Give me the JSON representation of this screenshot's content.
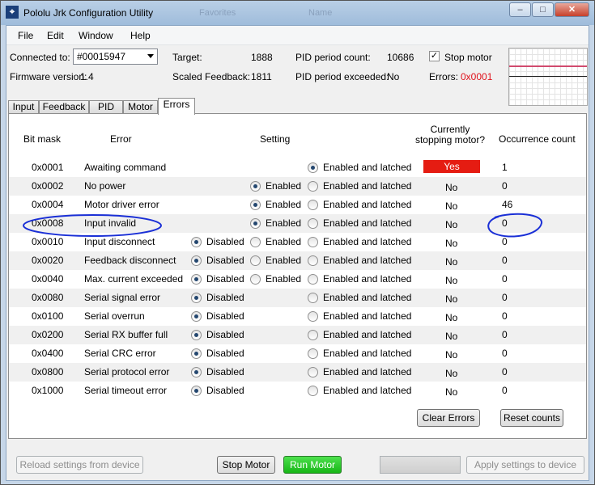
{
  "window": {
    "title": "Pololu Jrk Configuration Utility",
    "bg_items": [
      "Favorites",
      "Name"
    ]
  },
  "menu": [
    "File",
    "Edit",
    "Window",
    "Help"
  ],
  "status": {
    "connected_label": "Connected to:",
    "device": "#00015947",
    "firmware_label": "Firmware version:",
    "firmware_value": "1.4",
    "target_label": "Target:",
    "target_value": "1888",
    "scaled_label": "Scaled Feedback:",
    "scaled_value": "1811",
    "pid_count_label": "PID period count:",
    "pid_count_value": "10686",
    "pid_exceeded_label": "PID period exceeded:",
    "pid_exceeded_value": "No",
    "stop_motor_label": "Stop motor",
    "stop_motor_checked": true,
    "errors_label": "Errors:",
    "errors_value": "0x0001",
    "error_color": "#e0101a"
  },
  "tabs": [
    "Input",
    "Feedback",
    "PID",
    "Motor",
    "Errors"
  ],
  "active_tab": "Errors",
  "table": {
    "headers": {
      "bitmask": "Bit mask",
      "error": "Error",
      "setting": "Setting",
      "stopping1": "Currently",
      "stopping2": "stopping motor?",
      "count": "Occurrence count"
    },
    "options": {
      "disabled": "Disabled",
      "enabled": "Enabled",
      "latched": "Enabled and latched"
    },
    "rows": [
      {
        "mask": "0x0001",
        "name": "Awaiting command",
        "opts": [
          "latched"
        ],
        "sel": "latched",
        "stopping": "Yes",
        "count": "1"
      },
      {
        "mask": "0x0002",
        "name": "No power",
        "opts": [
          "enabled",
          "latched"
        ],
        "sel": "enabled",
        "stopping": "No",
        "count": "0"
      },
      {
        "mask": "0x0004",
        "name": "Motor driver error",
        "opts": [
          "enabled",
          "latched"
        ],
        "sel": "enabled",
        "stopping": "No",
        "count": "46"
      },
      {
        "mask": "0x0008",
        "name": "Input invalid",
        "opts": [
          "enabled",
          "latched"
        ],
        "sel": "enabled",
        "stopping": "No",
        "count": "0"
      },
      {
        "mask": "0x0010",
        "name": "Input disconnect",
        "opts": [
          "disabled",
          "enabled",
          "latched"
        ],
        "sel": "disabled",
        "stopping": "No",
        "count": "0"
      },
      {
        "mask": "0x0020",
        "name": "Feedback disconnect",
        "opts": [
          "disabled",
          "enabled",
          "latched"
        ],
        "sel": "disabled",
        "stopping": "No",
        "count": "0"
      },
      {
        "mask": "0x0040",
        "name": "Max. current exceeded",
        "opts": [
          "disabled",
          "enabled",
          "latched"
        ],
        "sel": "disabled",
        "stopping": "No",
        "count": "0"
      },
      {
        "mask": "0x0080",
        "name": "Serial signal error",
        "opts": [
          "disabled",
          "latched"
        ],
        "sel": "disabled",
        "stopping": "No",
        "count": "0"
      },
      {
        "mask": "0x0100",
        "name": "Serial overrun",
        "opts": [
          "disabled",
          "latched"
        ],
        "sel": "disabled",
        "stopping": "No",
        "count": "0"
      },
      {
        "mask": "0x0200",
        "name": "Serial RX buffer full",
        "opts": [
          "disabled",
          "latched"
        ],
        "sel": "disabled",
        "stopping": "No",
        "count": "0"
      },
      {
        "mask": "0x0400",
        "name": "Serial CRC error",
        "opts": [
          "disabled",
          "latched"
        ],
        "sel": "disabled",
        "stopping": "No",
        "count": "0"
      },
      {
        "mask": "0x0800",
        "name": "Serial protocol error",
        "opts": [
          "disabled",
          "latched"
        ],
        "sel": "disabled",
        "stopping": "No",
        "count": "0"
      },
      {
        "mask": "0x1000",
        "name": "Serial timeout error",
        "opts": [
          "disabled",
          "latched"
        ],
        "sel": "disabled",
        "stopping": "No",
        "count": "0"
      }
    ]
  },
  "buttons": {
    "clear_errors": "Clear Errors",
    "reset_counts": "Reset counts",
    "reload": "Reload settings from device",
    "stop_motor": "Stop Motor",
    "run_motor": "Run Motor",
    "apply": "Apply settings to device"
  },
  "colors": {
    "yes_badge": "#e51c12",
    "run_motor": "#22c322",
    "annotation": "#1a2fd6"
  }
}
